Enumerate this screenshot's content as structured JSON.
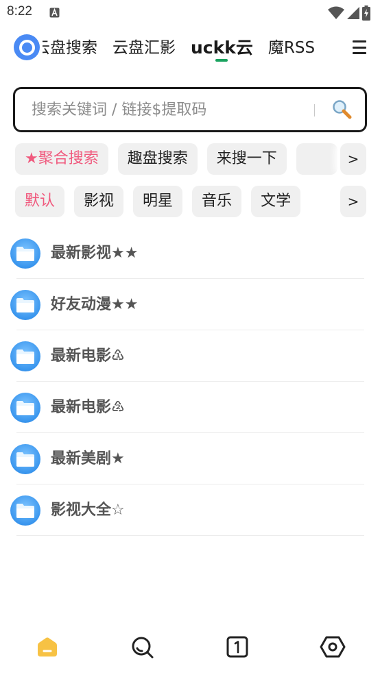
{
  "status_bar": {
    "time": "8:22",
    "icons": [
      "notification-a-icon",
      "wifi-icon",
      "signal-icon",
      "battery-charging-icon"
    ]
  },
  "top_tabs": {
    "items": [
      {
        "label": "云盘搜索",
        "active": false
      },
      {
        "label": "云盘汇影",
        "active": false
      },
      {
        "label": "uckk云",
        "active": true
      },
      {
        "label": "魔RSS",
        "active": false
      }
    ],
    "accent_color": "#1aa35f"
  },
  "search": {
    "placeholder": "搜索关键词 / 链接$提取码",
    "value": ""
  },
  "engine_chips": {
    "items": [
      {
        "label": "★聚合搜索",
        "active": true
      },
      {
        "label": "趣盘搜索",
        "active": false
      },
      {
        "label": "来搜一下",
        "active": false
      },
      {
        "label": "",
        "active": false
      }
    ],
    "more_label": ">"
  },
  "category_chips": {
    "items": [
      {
        "label": "默认",
        "active": true
      },
      {
        "label": "影视",
        "active": false
      },
      {
        "label": "明星",
        "active": false
      },
      {
        "label": "音乐",
        "active": false
      },
      {
        "label": "文学",
        "active": false
      }
    ],
    "more_label": ">",
    "active_color": "#f05a7e"
  },
  "folders": [
    {
      "label": "最新影视★★"
    },
    {
      "label": "好友动漫★★"
    },
    {
      "label": "最新电影♳"
    },
    {
      "label": "最新电影♴"
    },
    {
      "label": "最新美剧★"
    },
    {
      "label": "影视大全☆"
    }
  ],
  "bottom_nav": [
    {
      "icon": "home-icon",
      "active": true,
      "color": "#f7c244"
    },
    {
      "icon": "search-icon",
      "active": false
    },
    {
      "icon": "page-one-icon",
      "active": false
    },
    {
      "icon": "settings-hexagon-icon",
      "active": false
    }
  ]
}
